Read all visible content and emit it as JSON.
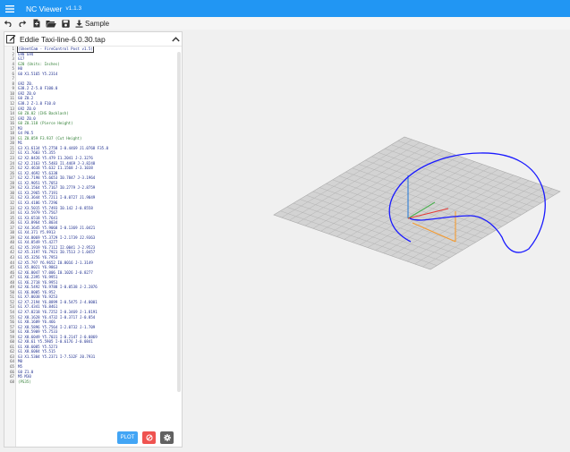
{
  "app": {
    "title": "NC Viewer",
    "version": "v1.1.3"
  },
  "toolbar": {
    "items": [
      {
        "icon": "undo-icon"
      },
      {
        "icon": "redo-icon"
      },
      {
        "icon": "new-file-icon"
      },
      {
        "icon": "open-folder-icon"
      },
      {
        "icon": "save-icon"
      },
      {
        "icon": "download-icon",
        "label": "Sample"
      }
    ]
  },
  "file": {
    "name": "Eddie Taxi-line-6.0.30.tap"
  },
  "code_lines": [
    "(SheetCam - FireControl Post v1.5)",
    "G90 G94",
    "G17",
    "G20 (Units: Inches)",
    "H0",
    "G0 X1.5165 Y5.2314",
    "",
    "G92 Z0.",
    "G38.2 Z-5.0 F100.0",
    "G92 Z0.0",
    "G0 Z0.2",
    "G38.2 Z-1.0 F10.0",
    "G92 Z0.0",
    "G0 Z0.02 (IHS Backlash)",
    "G92 Z0.0",
    "G0 Z0.118 (Pierce Height)",
    "M3",
    "G4 P0.5",
    "G1 Z0.059 F3.937 (Cut Height)",
    "M1",
    "G3 X1.6134 Y5.2758 I-0.4469 J1.0768 F35.0",
    "G1 X1.7603 Y5.355",
    "G2 X2.0426 Y5.479 I1.2041 J-2.3276",
    "G2 X2.2163 Y5.5483 I1.4469 J-3.8248",
    "G2 X2.4618 Y5.632 I1.1568 J-3.1038",
    "G1 X2.4692 Y5.6338",
    "G2 X2.7198 Y5.6653 I0.7847 J-3.1964",
    "G1 X2.9051 Y5.7053",
    "G2 X3.1564 Y5.7167 I0.2779 J-2.8759",
    "G1 X3.2965 Y5.7191",
    "G2 X3.3644 Y5.7211 I-0.0727 J1.9049",
    "G1 X3.4186 Y5.7296",
    "G2 X3.5015 Y5.7493 I0.142 J-0.8558",
    "G1 X3.5979 Y5.7567",
    "G1 X3.6518 Y5.7641",
    "G1 X3.8964 Y5.8034",
    "G2 X4.3645 Y5.9068 I-0.1369 J1.0421",
    "G1 X4.371 Y5.9913",
    "G2 X4.8069 Y5.3729 I-2.1739 J2.9363",
    "G1 X4.8549 Y5.4277",
    "G2 X5.1919 Y6.7112 I2.0041 J-2.9523",
    "G2 X5.3197 Y6.7921 I0.7513 J-1.0457",
    "G1 X5.3256 Y6.7953",
    "G2 X5.797 Y6.9652 I0.8016 J-1.3149",
    "G1 X5.8021 Y6.9863",
    "G2 X6.0047 Y7.006 I0.1026 J-0.8277",
    "G1 X6.2395 Y6.9951",
    "G1 X6.2718 Y6.9951",
    "G2 X6.5492 Y6.9788 I-0.0538 J-2.2876",
    "G1 X6.8005 Y6.952",
    "G1 X7.0038 Y6.9253",
    "G2 X7.2194 Y6.8899 I-0.5475 J-4.0001",
    "G1 X7.4341 Y6.8461",
    "G2 X7.8218 Y6.7252 I-0.3469 J-1.8191",
    "G2 X8.1628 Y6.4732 I-0.3717 J-0.854",
    "G1 X8.1689 Y6.466",
    "G2 X8.5896 Y5.7564 I-2.0732 J-1.709",
    "G1 X8.5909 Y5.7533",
    "G2 X8.6049 Y5.7031 I-0.2147 J-0.0869",
    "G2 X8.61 Y5.5905 I-0.6176 J-0.0841",
    "G1 X8.6085 Y5.5273",
    "G1 X8.6084 Y5.515",
    "G3 X1.5304 Y5.2371 I-7.532F J0.7931",
    "M0",
    "M5",
    "G0 Z1.0",
    "M5 M30",
    "(PS35)"
  ],
  "buttons": {
    "plot": "PLOT"
  },
  "colors": {
    "accent": "#2196f3",
    "plot": "#42a5f5",
    "stop": "#ef5350",
    "settings": "#616161",
    "toolpath": "#1a1aff"
  }
}
